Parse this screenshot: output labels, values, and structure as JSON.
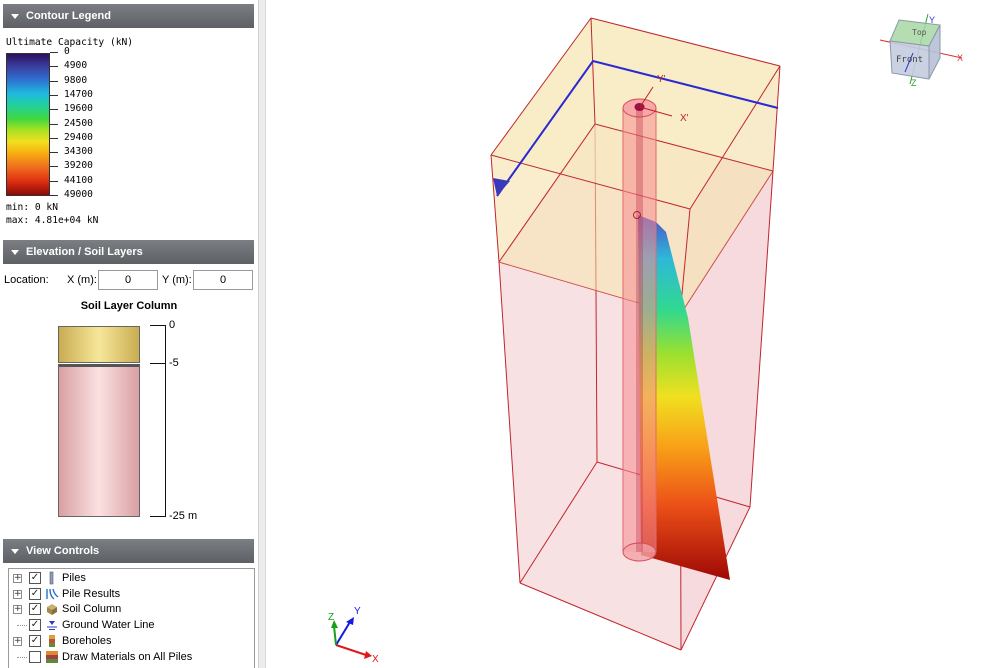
{
  "contour_legend": {
    "header": "Contour Legend",
    "title": "Ultimate Capacity (kN)",
    "ticks": [
      "0",
      "4900",
      "9800",
      "14700",
      "19600",
      "24500",
      "29400",
      "34300",
      "39200",
      "44100",
      "49000"
    ],
    "min_text": "min: 0 kN",
    "max_text": "max: 4.81e+04 kN"
  },
  "elevation": {
    "header": "Elevation / Soil Layers",
    "location_label": "Location:",
    "x_label": "X (m):",
    "x_value": "0",
    "y_label": "Y (m):",
    "y_value": "0",
    "soil_title": "Soil Layer Column",
    "ticks": [
      "0",
      "-5",
      "-25 m"
    ]
  },
  "view_controls": {
    "header": "View Controls",
    "items": [
      {
        "label": "Piles",
        "checked": true,
        "icon": "pile-icon"
      },
      {
        "label": "Pile Results",
        "checked": true,
        "icon": "pile-results-icon"
      },
      {
        "label": "Soil Column",
        "checked": true,
        "icon": "soil-column-icon"
      },
      {
        "label": "Ground Water Line",
        "checked": true,
        "icon": "ground-water-icon"
      },
      {
        "label": "Boreholes",
        "checked": true,
        "icon": "borehole-icon"
      },
      {
        "label": "Draw Materials on All Piles",
        "checked": false,
        "icon": "materials-icon"
      }
    ]
  },
  "viewport": {
    "local_axis_x": "X'",
    "local_axis_y": "Y'",
    "triad": {
      "x": "X",
      "y": "Y",
      "z": "Z"
    },
    "view_cube": {
      "top": "Top",
      "front": "Front",
      "x": "X",
      "y": "Y",
      "z": "Z"
    }
  }
}
